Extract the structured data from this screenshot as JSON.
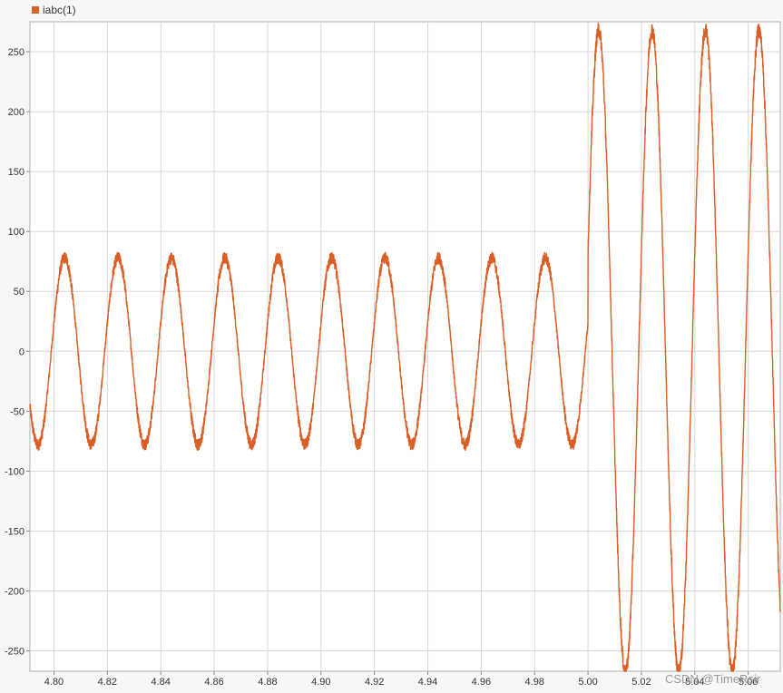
{
  "legend": {
    "label": "iabc(1)"
  },
  "watermark": "CSDN @TimeRsir",
  "chart_data": {
    "type": "line",
    "title": "",
    "xlabel": "",
    "ylabel": "",
    "xlim": [
      4.791,
      5.072
    ],
    "ylim": [
      -267,
      275
    ],
    "x_ticks": [
      4.8,
      4.82,
      4.84,
      4.86,
      4.88,
      4.9,
      4.92,
      4.94,
      4.96,
      4.98,
      5.0,
      5.02,
      5.04,
      5.06,
      5.08
    ],
    "x_tick_labels": [
      "4.80",
      "4.82",
      "4.84",
      "4.86",
      "4.88",
      "4.90",
      "4.92",
      "4.94",
      "4.96",
      "4.98",
      "5.00",
      "5.02",
      "5.04",
      "5.06",
      "5.08"
    ],
    "y_ticks": [
      250,
      200,
      150,
      100,
      50,
      0,
      -50,
      -100,
      -150,
      -200,
      -250
    ],
    "y_tick_labels": [
      "250",
      "200",
      "150",
      "100",
      "50",
      "0",
      "-50",
      "-100",
      "-150",
      "-200",
      "-250"
    ],
    "grid": true,
    "legend_position": "top-left",
    "colors": {
      "series": "#d95f27",
      "grid": "#d8d8d8",
      "plot_bg": "#ffffff",
      "page_bg": "#f7f7f7",
      "frame": "#b0b0b0"
    },
    "series": [
      {
        "name": "iabc(1)",
        "segments": [
          {
            "t_start": 4.791,
            "t_end": 5.0,
            "frequency_hz": 50,
            "amplitude": 78,
            "phase_deg": 0,
            "noise": 3
          },
          {
            "t_start": 5.0,
            "t_end": 5.072,
            "frequency_hz": 50,
            "amplitude": 268,
            "phase_deg": 0,
            "noise": 4
          }
        ],
        "points": [
          [
            4.791,
            -45
          ],
          [
            4.795,
            -78
          ],
          [
            4.8,
            45
          ],
          [
            4.804,
            78
          ],
          [
            4.81,
            -44
          ],
          [
            4.814,
            -79
          ],
          [
            4.82,
            43
          ],
          [
            4.824,
            78
          ],
          [
            4.83,
            -45
          ],
          [
            4.834,
            -78
          ],
          [
            4.84,
            45
          ],
          [
            4.844,
            78
          ],
          [
            4.85,
            -45
          ],
          [
            4.854,
            -78
          ],
          [
            4.86,
            45
          ],
          [
            4.864,
            78
          ],
          [
            4.87,
            -45
          ],
          [
            4.874,
            -78
          ],
          [
            4.88,
            45
          ],
          [
            4.884,
            78
          ],
          [
            4.89,
            -45
          ],
          [
            4.894,
            -78
          ],
          [
            4.9,
            45
          ],
          [
            4.904,
            77
          ],
          [
            4.91,
            -45
          ],
          [
            4.914,
            -79
          ],
          [
            4.92,
            45
          ],
          [
            4.924,
            78
          ],
          [
            4.93,
            -45
          ],
          [
            4.934,
            -78
          ],
          [
            4.94,
            45
          ],
          [
            4.944,
            78
          ],
          [
            4.95,
            -45
          ],
          [
            4.954,
            -78
          ],
          [
            4.96,
            45
          ],
          [
            4.964,
            78
          ],
          [
            4.97,
            -45
          ],
          [
            4.974,
            -78
          ],
          [
            4.98,
            45
          ],
          [
            4.984,
            78
          ],
          [
            4.99,
            -45
          ],
          [
            4.994,
            -78
          ],
          [
            5.0,
            35
          ],
          [
            5.004,
            256
          ],
          [
            5.01,
            -160
          ],
          [
            5.014,
            -265
          ],
          [
            5.02,
            160
          ],
          [
            5.024,
            265
          ],
          [
            5.03,
            -160
          ],
          [
            5.034,
            -268
          ],
          [
            5.04,
            160
          ],
          [
            5.044,
            268
          ],
          [
            5.05,
            -160
          ],
          [
            5.054,
            -268
          ],
          [
            5.06,
            160
          ],
          [
            5.064,
            268
          ],
          [
            5.07,
            -160
          ],
          [
            5.072,
            -268
          ]
        ]
      }
    ]
  }
}
